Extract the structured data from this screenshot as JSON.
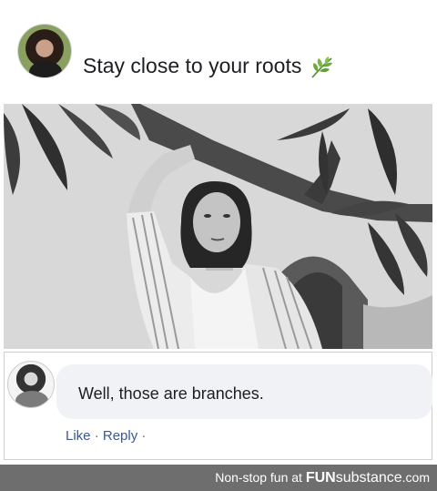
{
  "post": {
    "caption": "Stay close to your roots",
    "caption_icon": "herb-leaf-icon"
  },
  "comment": {
    "text": "Well, those are branches.",
    "actions": {
      "like_label": "Like",
      "separator": "·",
      "reply_label": "Reply",
      "trailing_separator": "·"
    }
  },
  "footer": {
    "tagline": "Non-stop fun at",
    "brand_fun": "FUN",
    "brand_substance": "substance",
    "brand_tld": ".com"
  },
  "colors": {
    "link": "#385898",
    "bubble": "#f0f2f5",
    "footer": "#6e6e6e",
    "text": "#1c1e21"
  }
}
